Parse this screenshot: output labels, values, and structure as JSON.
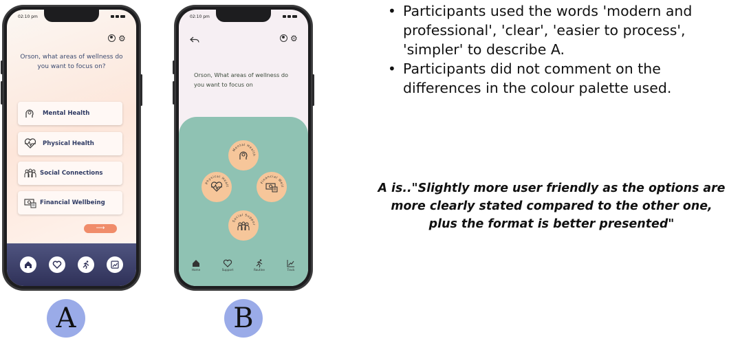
{
  "phoneA": {
    "time": "02:10 pm",
    "question": "Orson, what areas of wellness do you want to focus on?",
    "options": [
      "Mental Health",
      "Physical Health",
      "Social Connections",
      "Financial Wellbeing"
    ],
    "next_arrow": "⟶",
    "nav_icons": [
      "home-icon",
      "heart-icon",
      "running-icon",
      "chart-icon"
    ],
    "label": "A"
  },
  "phoneB": {
    "time": "02:10 pm",
    "question": "Orson, What areas of wellness do you want to focus on",
    "circles": [
      {
        "label": "Mental Health",
        "icon": "head-icon"
      },
      {
        "label": "Physical Health",
        "icon": "heart-pulse-icon"
      },
      {
        "label": "Financial Well",
        "icon": "money-icon"
      },
      {
        "label": "Social Support",
        "icon": "people-icon"
      }
    ],
    "nav": [
      "Home",
      "Support",
      "Routine",
      "Track"
    ],
    "label": "B"
  },
  "bullets": [
    "Participants used the words 'modern and professional', 'clear', 'easier to process', 'simpler' to describe A.",
    "Participants did not comment on the differences in the colour palette used."
  ],
  "quote": "A is..\"Slightly more user friendly as the options are more clearly stated compared to the other one, plus the format is better presented\"",
  "colors": {
    "accent_orange": "#f08c6a",
    "navy_nav": "#2f3158",
    "green_panel": "#8fc2b3",
    "circle_peach": "#f6c69a",
    "label_blue": "#9aabe8"
  }
}
